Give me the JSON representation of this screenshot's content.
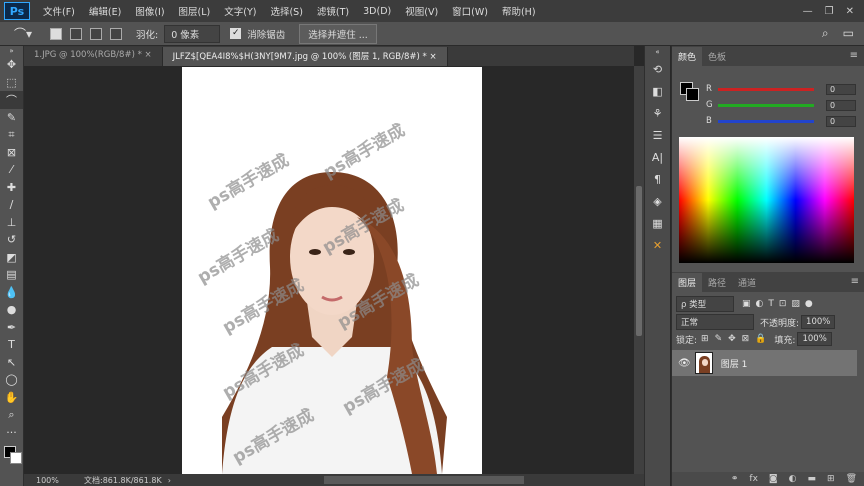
{
  "app": {
    "logo": "Ps"
  },
  "menu": [
    "文件(F)",
    "编辑(E)",
    "图像(I)",
    "图层(L)",
    "文字(Y)",
    "选择(S)",
    "滤镜(T)",
    "3D(D)",
    "视图(V)",
    "窗口(W)",
    "帮助(H)"
  ],
  "window_controls": [
    "—",
    "❐",
    "✕"
  ],
  "options": {
    "feather_label": "羽化:",
    "feather_value": "0 像素",
    "antialias_label": "消除锯齿",
    "select_mask": "选择并遮住 ..."
  },
  "tabs": [
    {
      "label": "1.JPG @ 100%(RGB/8#) *",
      "close": "×"
    },
    {
      "label": "JLFZ$[QEA4I8%$H(3NY[9M7.jpg @ 100% (图层 1, RGB/8#) *",
      "close": "×"
    }
  ],
  "watermark": "ps高手速成",
  "status": {
    "zoom": "100%",
    "doc": "文档:861.8K/861.8K",
    "arrow": "›"
  },
  "color_panel": {
    "tabs": [
      "颜色",
      "色板"
    ],
    "r_label": "R",
    "g_label": "G",
    "b_label": "B",
    "r_value": "0",
    "g_value": "0",
    "b_value": "0",
    "colors": {
      "r": "#cc2222",
      "g": "#22aa22",
      "b": "#2244cc"
    }
  },
  "layers_panel": {
    "tabs": [
      "图层",
      "路径",
      "通道"
    ],
    "filter": "ρ 类型",
    "blend": "正常",
    "opacity_label": "不透明度:",
    "opacity": "100%",
    "lock_label": "锁定:",
    "fill_label": "填充:",
    "fill": "100%",
    "layer_name": "图层 1"
  }
}
